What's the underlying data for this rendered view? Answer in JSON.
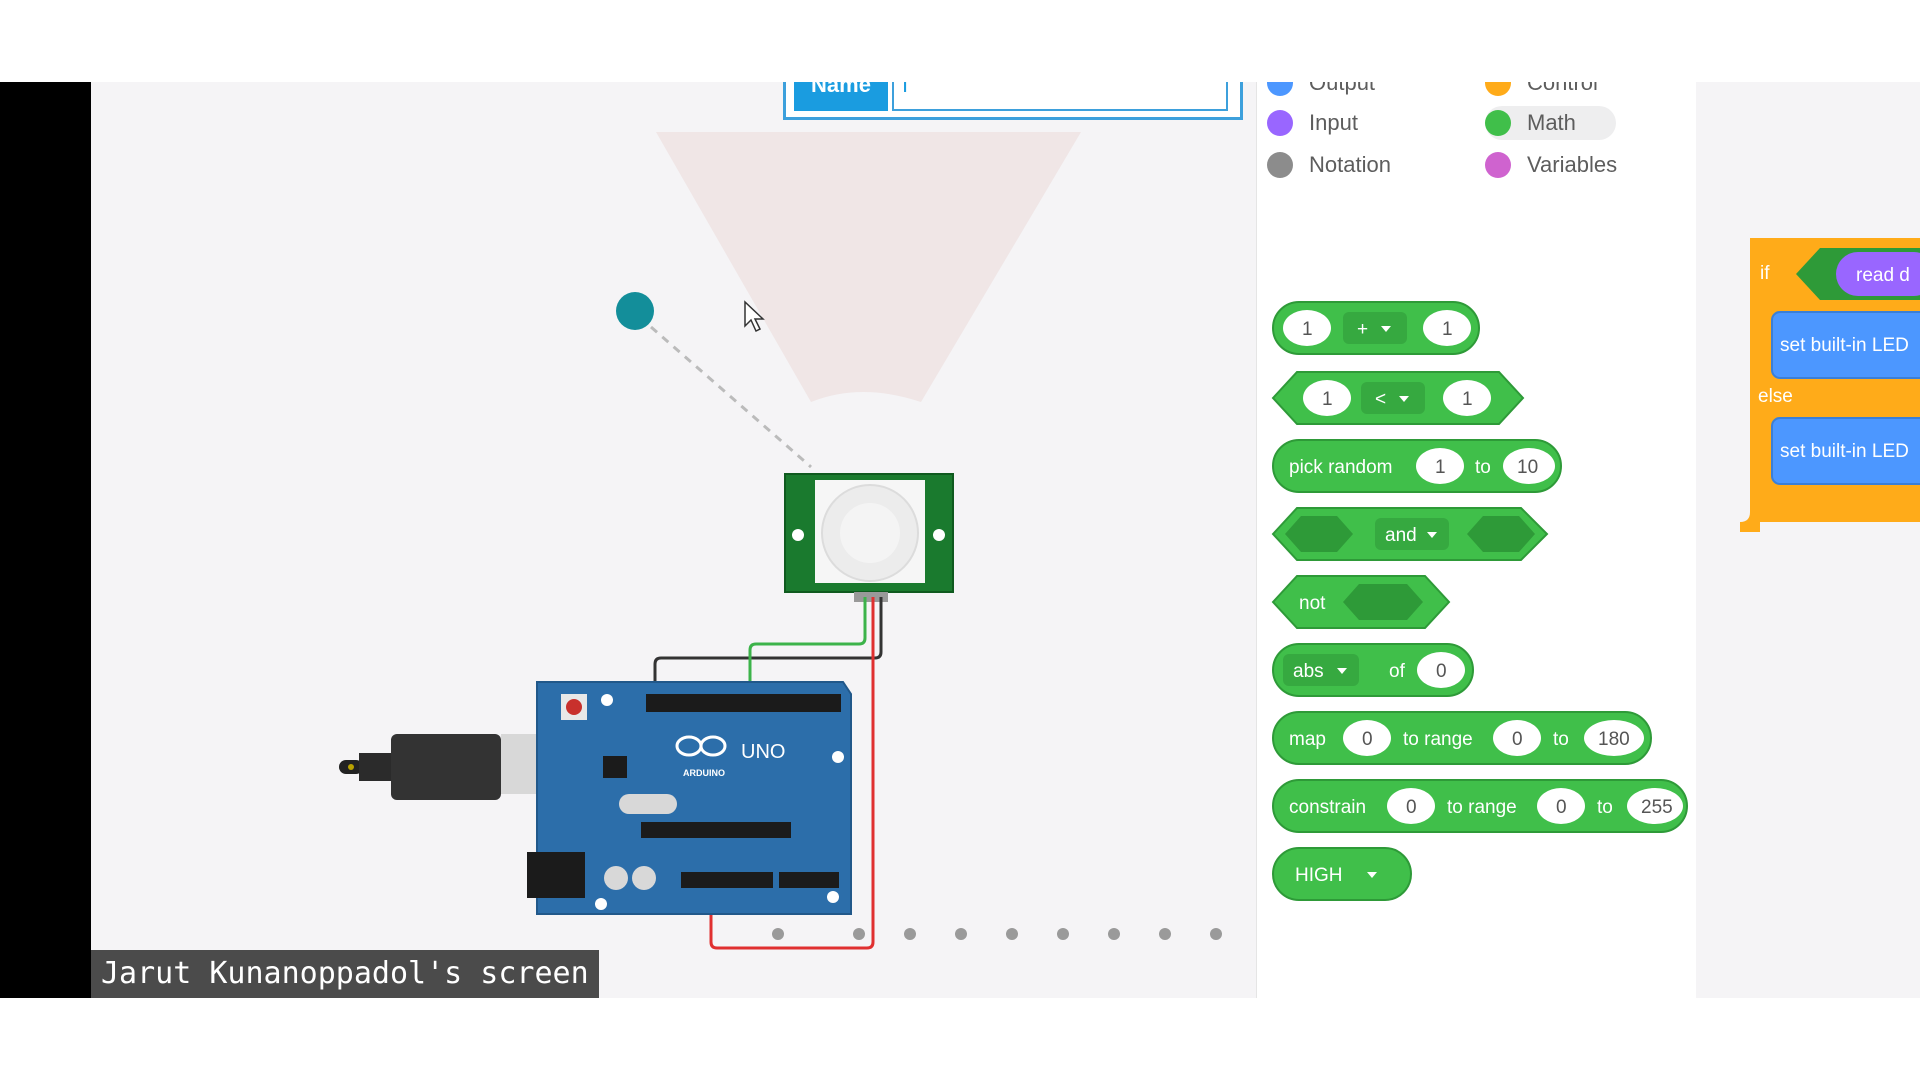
{
  "name_popup": {
    "label": "Name",
    "value": "I"
  },
  "screen_label": "Jarut Kunanoppadol's screen",
  "categories": [
    {
      "label": "Output",
      "color": "#4c97ff"
    },
    {
      "label": "Control",
      "color": "#ffab19"
    },
    {
      "label": "Input",
      "color": "#9966ff"
    },
    {
      "label": "Math",
      "color": "#40bf4a"
    },
    {
      "label": "Notation",
      "color": "#8c8c8c"
    },
    {
      "label": "Variables",
      "color": "#cf63cf"
    }
  ],
  "math_blocks": {
    "add": {
      "a": "1",
      "op": "+",
      "b": "1"
    },
    "compare": {
      "a": "1",
      "op": "<",
      "b": "1"
    },
    "random": {
      "label": "pick random",
      "from": "1",
      "to_label": "to",
      "to": "10"
    },
    "and": {
      "label": "and"
    },
    "not": {
      "label": "not"
    },
    "abs": {
      "label": "abs",
      "of": "of",
      "value": "0"
    },
    "map": {
      "label": "map",
      "value": "0",
      "range_label": "to range",
      "min": "0",
      "to_label": "to",
      "max": "180"
    },
    "constrain": {
      "label": "constrain",
      "value": "0",
      "range_label": "to range",
      "min": "0",
      "to_label": "to",
      "max": "255"
    },
    "high": {
      "label": "HIGH"
    }
  },
  "workspace": {
    "if_label": "if",
    "read_label": "read d",
    "set_led_1": "set built-in LED",
    "else_label": "else",
    "set_led_2": "set built-in LED"
  },
  "arduino": {
    "brand": "ARDUINO",
    "model": "UNO"
  },
  "colors": {
    "math": "#40bf4a",
    "control": "#ffab19",
    "output": "#4c97ff",
    "input": "#9966ff",
    "board": "#2c6eaa",
    "sensor": "#1a7a2e"
  }
}
